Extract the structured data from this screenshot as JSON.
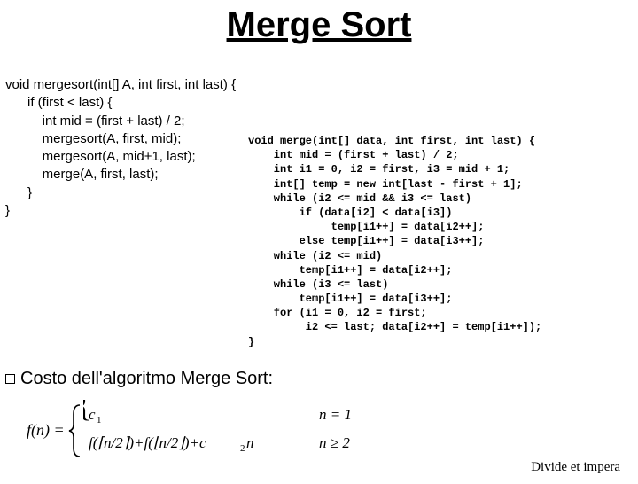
{
  "title": "Merge Sort",
  "code_left": "void mergesort(int[] A, int first, int last) {\n      if (first < last) {\n          int mid = (first + last) / 2;\n          mergesort(A, first, mid);\n          mergesort(A, mid+1, last);\n          merge(A, first, last);\n      }\n}",
  "code_right": "void merge(int[] data, int first, int last) {\n    int mid = (first + last) / 2;\n    int i1 = 0, i2 = first, i3 = mid + 1;\n    int[] temp = new int[last - first + 1];\n    while (i2 <= mid && i3 <= last)\n        if (data[i2] < data[i3])\n             temp[i1++] = data[i2++];\n        else temp[i1++] = data[i3++];\n    while (i2 <= mid)\n        temp[i1++] = data[i2++];\n    while (i3 <= last)\n        temp[i1++] = data[i3++];\n    for (i1 = 0, i2 = first;\n         i2 <= last; data[i2++] = temp[i1++]);\n}",
  "costo_label": "Costo dell'algoritmo Merge Sort:",
  "footer": "Divide et impera",
  "formula": {
    "lhs": "f(n)",
    "case1_rhs": "c₁",
    "case1_cond": "n = 1",
    "case2_rhs": "f(⌈n/2⌉) + f(⌊n/2⌋) + c₂n",
    "case2_cond": "n ≥ 2"
  }
}
